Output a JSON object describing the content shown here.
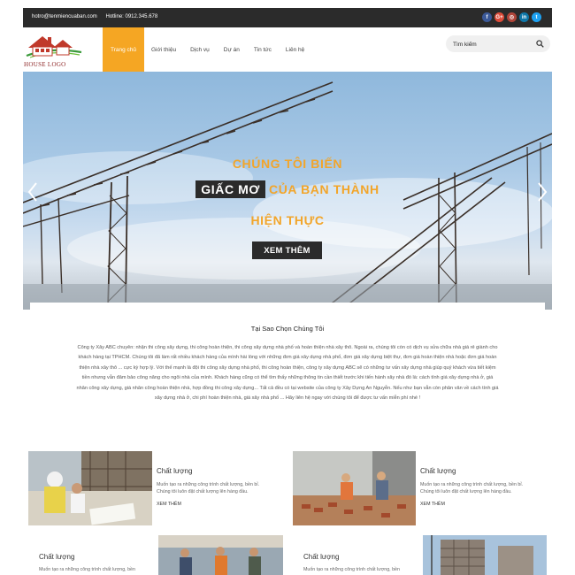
{
  "topbar": {
    "email": "hotro@tenmiencuaban.com",
    "hotline": "Hotline: 0912.345.678"
  },
  "socials": [
    {
      "name": "facebook-icon",
      "glyph": "f",
      "color": "#3b5998"
    },
    {
      "name": "google-plus-icon",
      "glyph": "G+",
      "color": "#dd4b39"
    },
    {
      "name": "instagram-icon",
      "glyph": "◎",
      "color": "#b0453a"
    },
    {
      "name": "linkedin-icon",
      "glyph": "in",
      "color": "#0e76a8"
    },
    {
      "name": "twitter-icon",
      "glyph": "t",
      "color": "#1da1f2"
    }
  ],
  "logo": {
    "text": "HOUSE LOGO"
  },
  "nav": {
    "items": [
      "Trang chủ",
      "Giới thiệu",
      "Dịch vụ",
      "Dự án",
      "Tin tức",
      "Liên hệ"
    ],
    "active": 0
  },
  "search": {
    "placeholder": "Tìm kiếm"
  },
  "hero": {
    "line1": "CHÚNG TÔI BIẾN",
    "line2_dark": "GIẤC MƠ",
    "line2_rest": "CỦA BẠN THÀNH",
    "line3": "HIỆN THỰC",
    "button": "XEM THÊM"
  },
  "about": {
    "title": "Tại Sao Chọn Chúng Tôi",
    "text": "Công ty Xây ABC chuyên: nhận thi công xây dựng, thi công hoàn thiện, thi công xây dựng nhà phố và hoàn thiện nhà xây thô. Ngoài ra, chúng tôi còn có dịch vụ sửa chữa nhà giá rẻ giành cho khách hàng tại TPHCM. Chúng tôi đã làm rất nhiều khách hàng của mình hài lòng với những đơn giá xây dựng nhà phố, đơn giá xây dựng biệt thự, đơn giá hoàn thiện nhà hoặc đơn giá hoàn thiện nhà xây thô ... cực kỳ hợp lý. Với thế mạnh là đội thi công xây dựng nhà phố, thi công hoàn thiện, công ty xây dựng ABC sẽ có những tư vấn xây dựng nhà giúp quý khách vừa tiết kiệm tiền nhưng vẫn đảm bảo công năng cho ngôi nhà của mình. Khách hàng cũng có thể tìm thấy những thông tin cần thiết trước khi tiến hành xây nhà đó là: cách tính giá xây dựng nhà ở, giá nhân công xây dựng, giá nhân công hoàn thiện nhà, hợp đồng thi công xây dựng... Tất cả đều có tại website của công ty Xây Dựng An Nguyễn. Nếu như bạn vẫn còn phân vân về cách tính giá xây dựng nhà ở, chi phí hoàn thiện nhà, giá xây nhà phố ... Hãy liên hệ ngay với chúng tôi để được tư vấn miễn phí nhé !"
  },
  "cards": [
    {
      "title": "Chất lượng",
      "desc": "Muốn tạo ra những công trình chất lượng, bền bỉ. Chúng tôi luôn đặt chất lượng lên hàng đầu.",
      "more": "XEM THÊM"
    },
    {
      "title": "Chất lượng",
      "desc": "Muốn tạo ra những công trình chất lượng, bền bỉ. Chúng tôi luôn đặt chất lượng lên hàng đầu.",
      "more": "XEM THÊM"
    },
    {
      "title": "Chất lượng",
      "desc": "Muốn tạo ra những công trình chất lượng, bền",
      "more": ""
    },
    {
      "title": "Chất lượng",
      "desc": "Muốn tạo ra những công trình chất lượng, bền",
      "more": ""
    }
  ],
  "colors": {
    "accent": "#f5a623",
    "dark": "#2b2b2b",
    "hero_text": "#f2a52a"
  }
}
